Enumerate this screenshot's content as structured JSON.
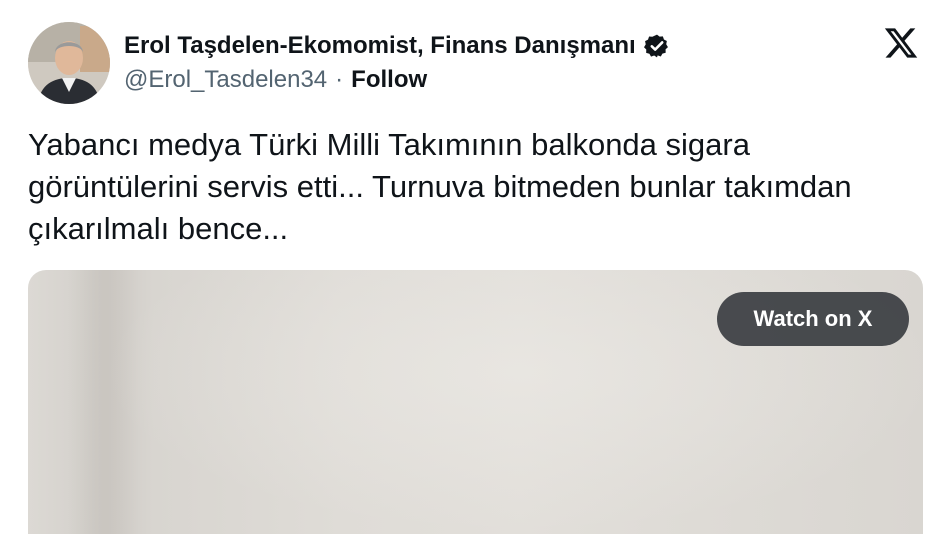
{
  "author": {
    "name": "Erol Taşdelen-Ekomomist, Finans Danışmanı",
    "handle": "@Erol_Tasdelen34",
    "separator": "·",
    "follow_label": "Follow",
    "verified": true,
    "badge_icon": "verified-badge-icon"
  },
  "platform_icon": "x-logo-icon",
  "tweet": {
    "text": "Yabancı medya Türki Milli Takımının balkonda sigara görüntülerini servis etti... Turnuva bitmeden bunlar takımdan çıkarılmalı bence..."
  },
  "media": {
    "watch_label": "Watch on X"
  },
  "colors": {
    "text_primary": "#0f1419",
    "text_secondary": "#536471",
    "watch_button_bg": "#32363a"
  }
}
